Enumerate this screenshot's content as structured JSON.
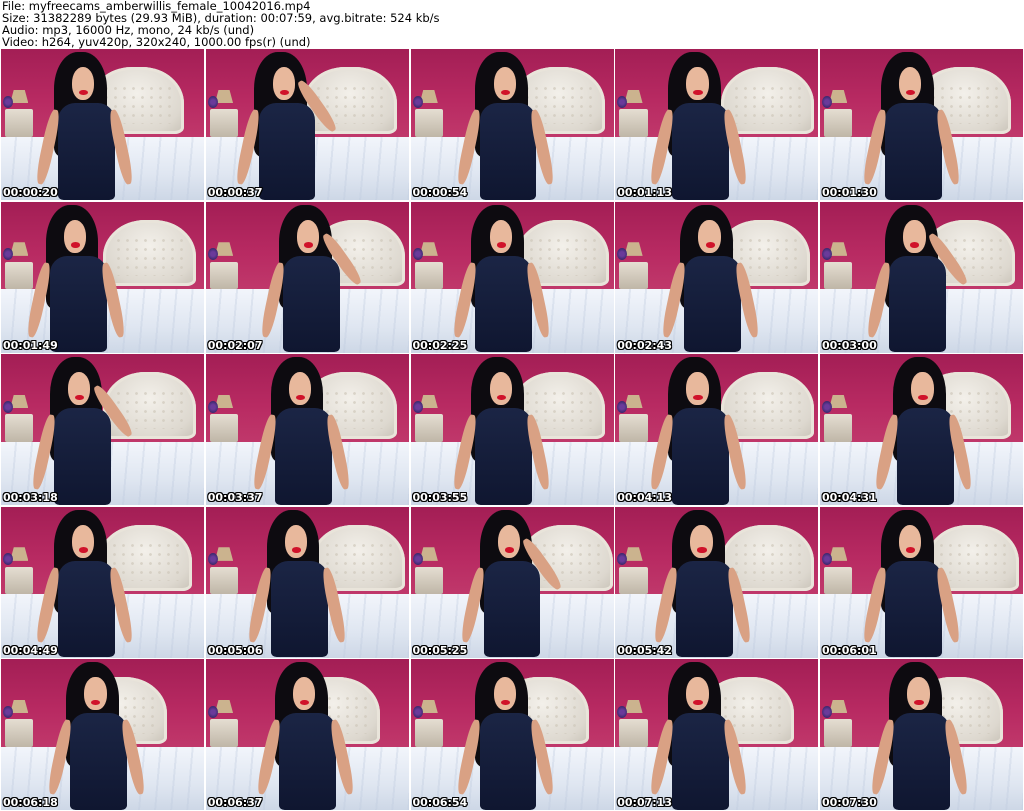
{
  "header": {
    "file_line": "File: myfreecams_amberwillis_female_10042016.mp4",
    "size_line": "Size: 31382289 bytes (29.93 MiB), duration: 00:07:59, avg.bitrate: 524 kb/s",
    "audio_line": "Audio: mp3, 16000 Hz, mono, 24 kb/s (und)",
    "video_line": "Video: h264, yuv420p, 320x240, 1000.00 fps(r) (und)"
  },
  "thumbnails": [
    {
      "timestamp": "00:00:20"
    },
    {
      "timestamp": "00:00:37"
    },
    {
      "timestamp": "00:00:54"
    },
    {
      "timestamp": "00:01:13"
    },
    {
      "timestamp": "00:01:30"
    },
    {
      "timestamp": "00:01:49"
    },
    {
      "timestamp": "00:02:07"
    },
    {
      "timestamp": "00:02:25"
    },
    {
      "timestamp": "00:02:43"
    },
    {
      "timestamp": "00:03:00"
    },
    {
      "timestamp": "00:03:18"
    },
    {
      "timestamp": "00:03:37"
    },
    {
      "timestamp": "00:03:55"
    },
    {
      "timestamp": "00:04:13"
    },
    {
      "timestamp": "00:04:31"
    },
    {
      "timestamp": "00:04:49"
    },
    {
      "timestamp": "00:05:06"
    },
    {
      "timestamp": "00:05:25"
    },
    {
      "timestamp": "00:05:42"
    },
    {
      "timestamp": "00:06:01"
    },
    {
      "timestamp": "00:06:18"
    },
    {
      "timestamp": "00:06:37"
    },
    {
      "timestamp": "00:06:54"
    },
    {
      "timestamp": "00:07:13"
    },
    {
      "timestamp": "00:07:30"
    }
  ],
  "colors": {
    "wall": "#b2295a",
    "bedding": "#e4eaf3",
    "outfit": "#141c38",
    "hair": "#0d0b10",
    "lips": "#d0122a",
    "timestamp_text": "#ffffff",
    "timestamp_outline": "#000000"
  }
}
